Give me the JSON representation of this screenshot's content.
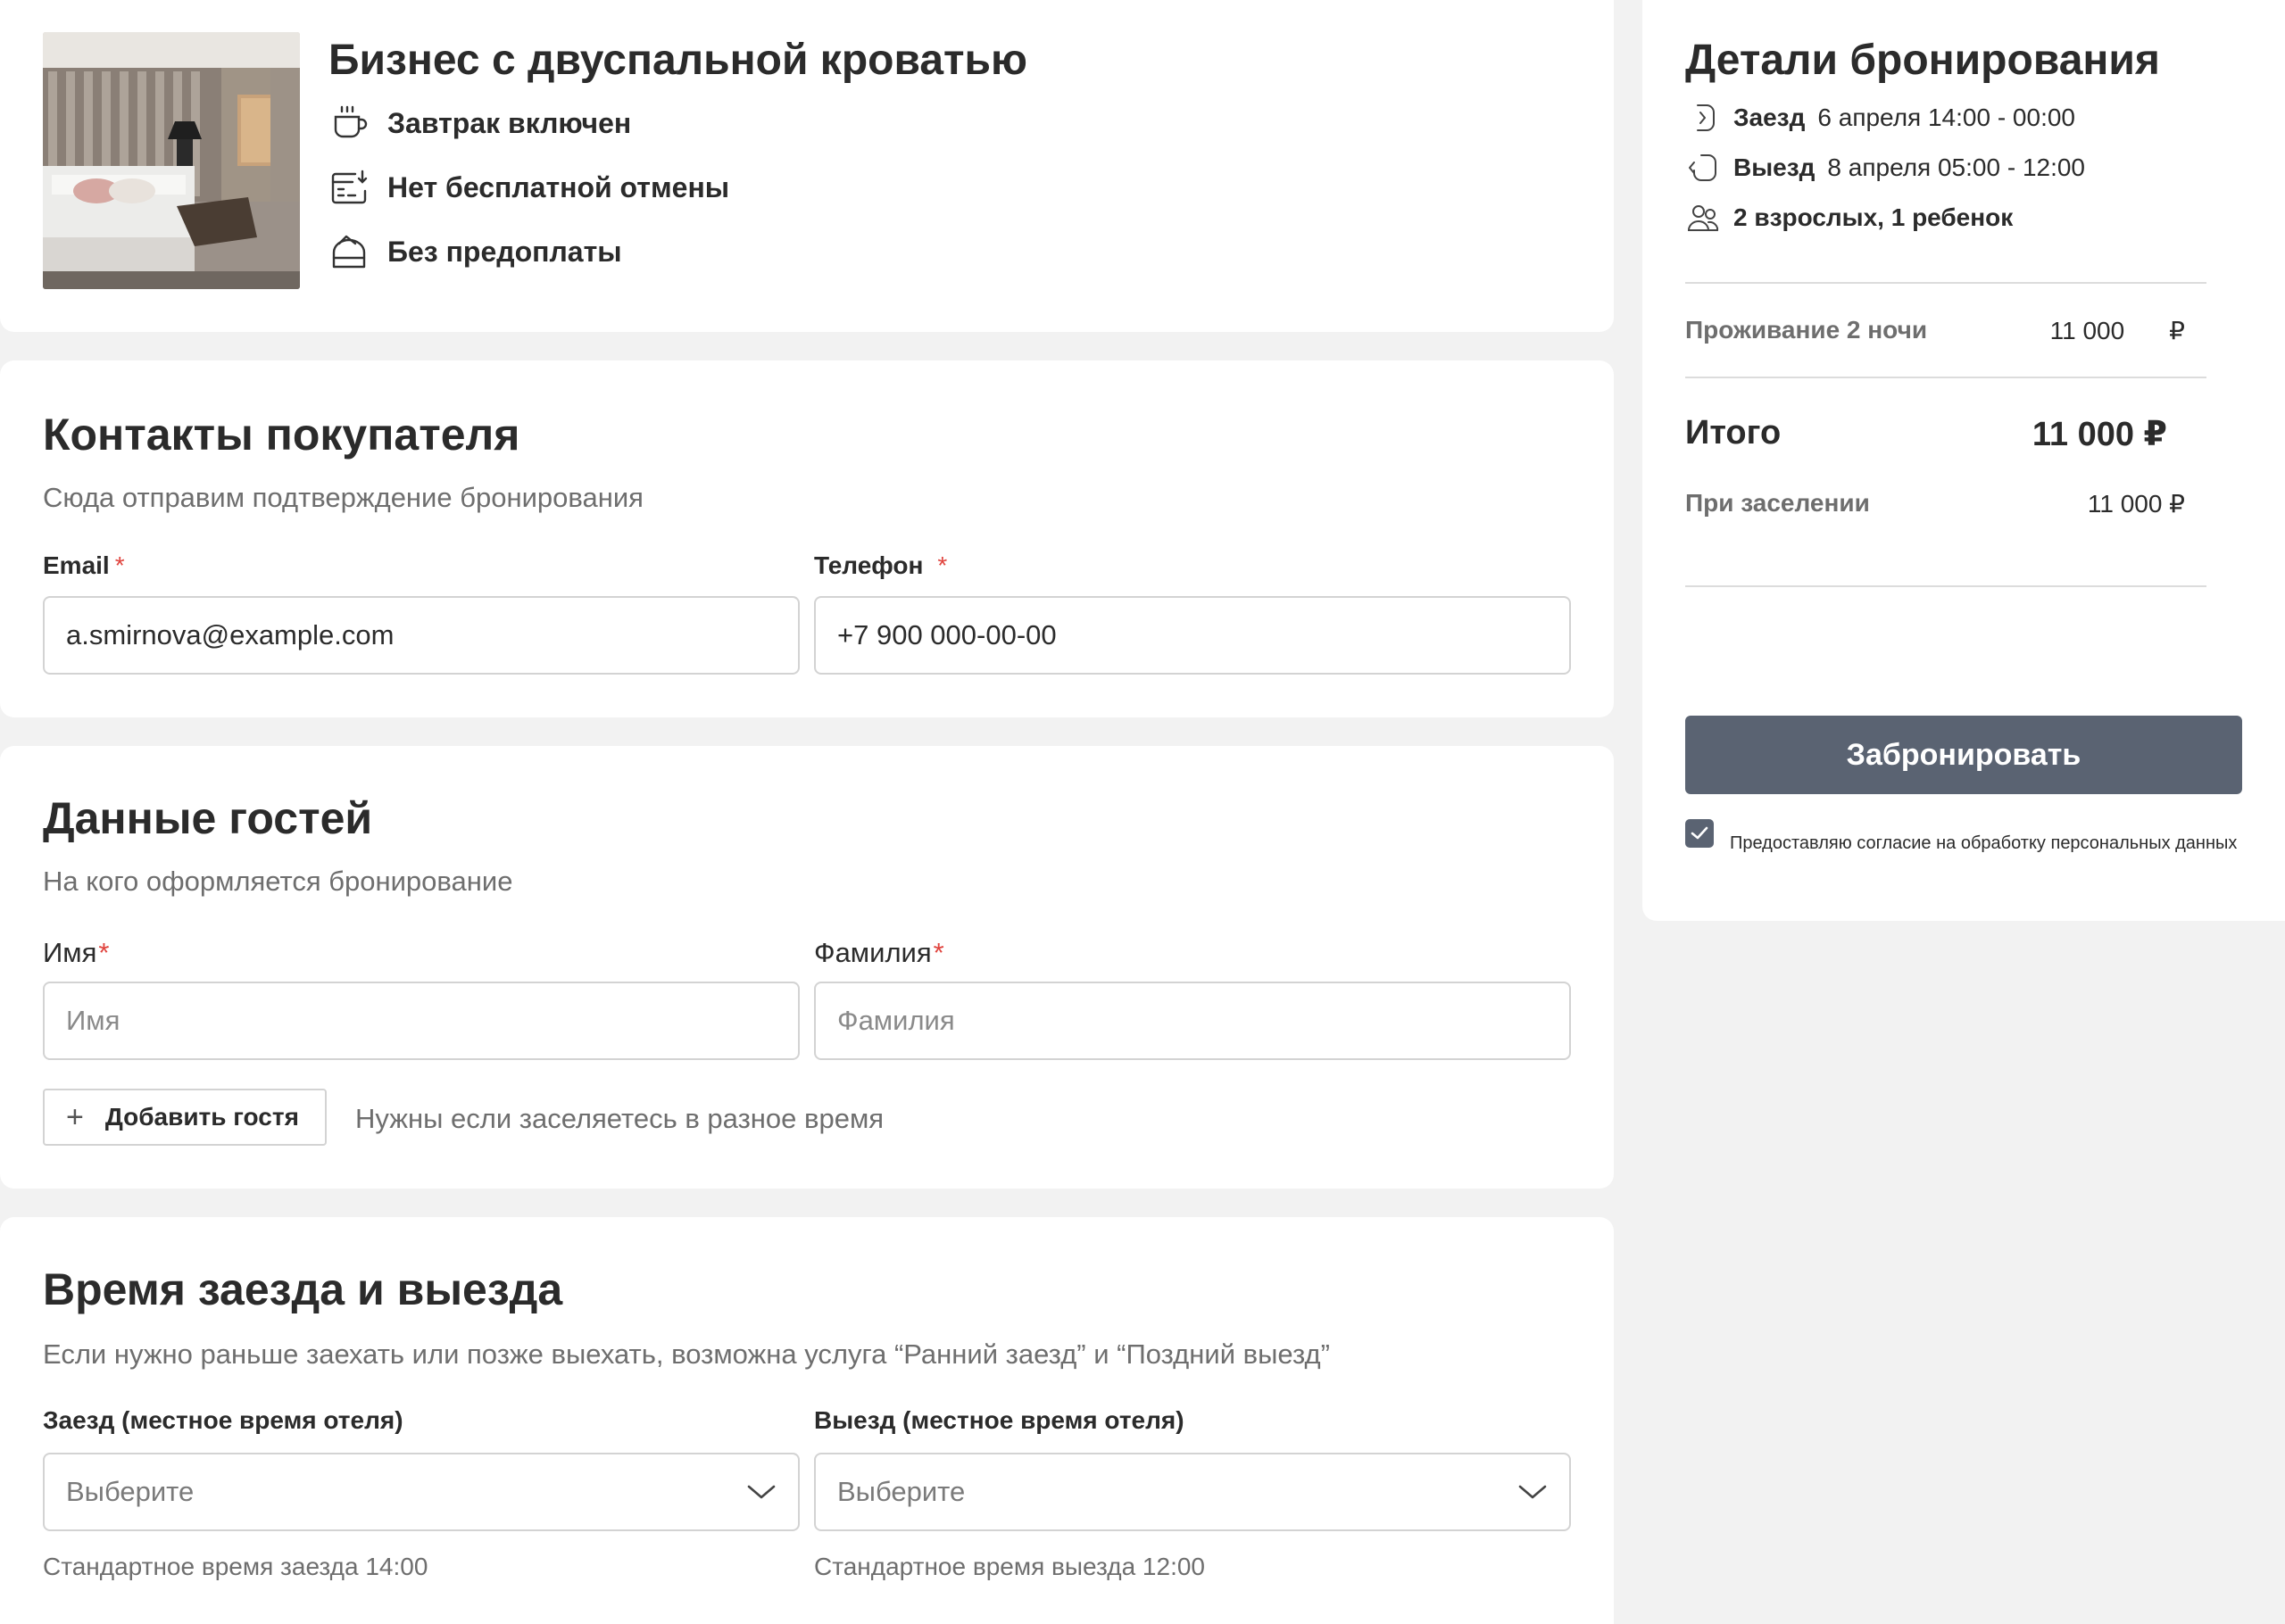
{
  "room": {
    "title": "Бизнес с двуспальной кроватью",
    "features": [
      {
        "icon": "coffee-cup-icon",
        "label": "Завтрак включен"
      },
      {
        "icon": "calendar-cancel-icon",
        "label": "Нет бесплатной отмены"
      },
      {
        "icon": "wallet-icon",
        "label": "Без предоплаты"
      }
    ]
  },
  "contacts": {
    "title": "Контакты покупателя",
    "subtitle": "Сюда отправим подтверждение бронирования",
    "email_label": "Email",
    "email_value": "a.smirnova@example.com",
    "phone_label": "Телефон",
    "phone_value": "+7 900 000-00-00",
    "required_mark": "*"
  },
  "guests": {
    "title": "Данные гостей",
    "subtitle": "На кого оформляется бронирование",
    "first_name_label": "Имя",
    "first_name_placeholder": "Имя",
    "last_name_label": "Фамилия",
    "last_name_placeholder": "Фамилия",
    "add_guest_label": "Добавить гостя",
    "add_guest_hint": "Нужны если заселяетесь в разное время"
  },
  "times": {
    "title": "Время заезда и выезда",
    "subtitle": "Если нужно раньше заехать или позже выехать, возможна услуга “Ранний заезд” и “Поздний выезд”",
    "checkin_label": "Заезд (местное время отеля)",
    "checkin_value": "Выберите",
    "checkin_hint": "Стандартное время заезда 14:00",
    "checkout_label": "Выезд (местное время отеля)",
    "checkout_value": "Выберите",
    "checkout_hint": "Стандартное время выезда 12:00"
  },
  "details": {
    "title": "Детали бронирования",
    "checkin_label": "Заезд",
    "checkin_value": "6 апреля 14:00 - 00:00",
    "checkout_label": "Выезд",
    "checkout_value": "8 апреля 05:00 - 12:00",
    "guests": "2 взрослых, 1 ребенок",
    "stay_label": "Проживание 2 ночи",
    "stay_amount": "11 000",
    "stay_currency": "₽",
    "total_label": "Итого",
    "total_value": "11 000 ₽",
    "on_arrival_label": "При заселении",
    "on_arrival_value": "11 000 ₽",
    "book_button": "Забронировать",
    "consent_text": "Предоставляю согласие на обработку персональных данных",
    "consent_checked": true
  },
  "colors": {
    "page_bg": "#f2f2f2",
    "card_bg": "#ffffff",
    "primary_button": "#5a6372",
    "required": "#e0443e"
  }
}
